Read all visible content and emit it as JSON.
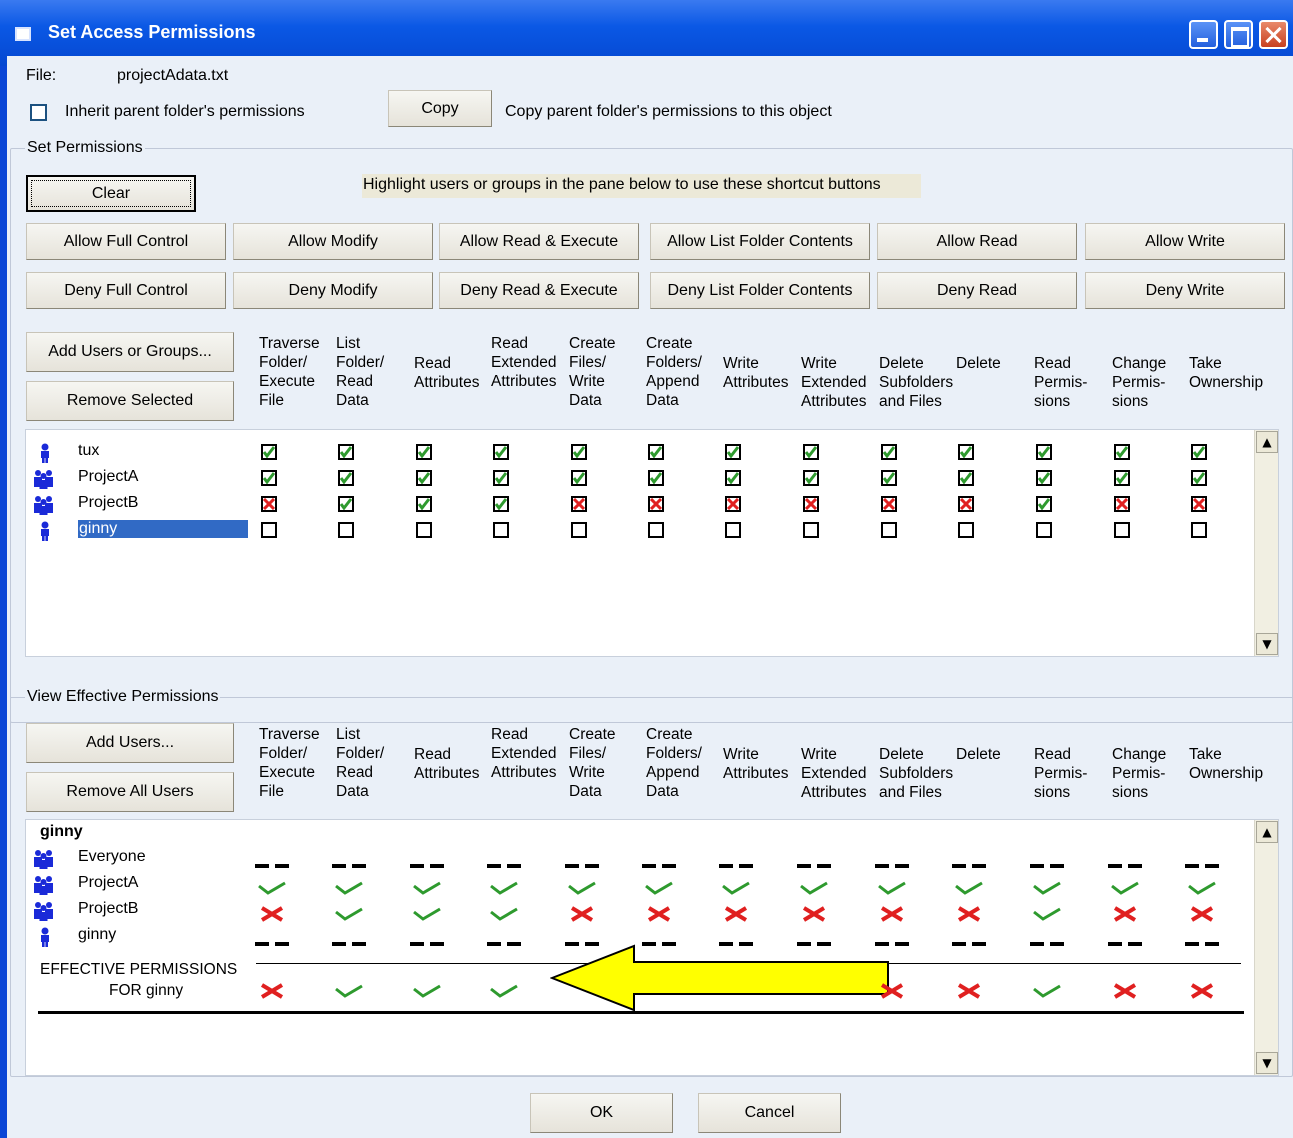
{
  "window": {
    "title": "Set Access Permissions"
  },
  "file": {
    "label": "File:",
    "name": "projectAdata.txt"
  },
  "inherit": {
    "label": "Inherit parent folder's permissions",
    "checked": false
  },
  "copy": {
    "button": "Copy",
    "desc": "Copy parent folder's permissions to this object"
  },
  "set_permissions": {
    "title": "Set Permissions",
    "clear_button": "Clear",
    "hint": "Highlight users or groups in the pane below to use these shortcut buttons",
    "allow_buttons": [
      "Allow Full Control",
      "Allow Modify",
      "Allow Read & Execute",
      "Allow List Folder Contents",
      "Allow Read",
      "Allow Write"
    ],
    "deny_buttons": [
      "Deny Full Control",
      "Deny Modify",
      "Deny Read & Execute",
      "Deny List Folder Contents",
      "Deny Read",
      "Deny Write"
    ],
    "add_button": "Add Users or Groups...",
    "remove_button": "Remove Selected",
    "columns": [
      "Traverse\nFolder/\nExecute\nFile",
      "List\nFolder/\nRead\nData",
      "Read\nAttributes",
      "Read\nExtended\nAttributes",
      "Create\nFiles/\nWrite\nData",
      "Create\nFolders/\nAppend\nData",
      "Write\nAttributes",
      "Write\nExtended\nAttributes",
      "Delete\nSubfolders\nand Files",
      "Delete",
      "Read\nPermis-\nsions",
      "Change\nPermis-\nsions",
      "Take\nOwnership"
    ],
    "rows": [
      {
        "name": "tux",
        "icon": "user-icon",
        "states": [
          "allow",
          "allow",
          "allow",
          "allow",
          "allow",
          "allow",
          "allow",
          "allow",
          "allow",
          "allow",
          "allow",
          "allow",
          "allow"
        ]
      },
      {
        "name": "ProjectA",
        "icon": "group-icon",
        "states": [
          "allow",
          "allow",
          "allow",
          "allow",
          "allow",
          "allow",
          "allow",
          "allow",
          "allow",
          "allow",
          "allow",
          "allow",
          "allow"
        ]
      },
      {
        "name": "ProjectB",
        "icon": "group-icon",
        "states": [
          "deny",
          "allow",
          "allow",
          "allow",
          "deny",
          "deny",
          "deny",
          "deny",
          "deny",
          "deny",
          "allow",
          "deny",
          "deny"
        ]
      },
      {
        "name": "ginny",
        "icon": "user-icon",
        "selected": true,
        "states": [
          "none",
          "none",
          "none",
          "none",
          "none",
          "none",
          "none",
          "none",
          "none",
          "none",
          "none",
          "none",
          "none"
        ]
      }
    ]
  },
  "effective": {
    "title": "View Effective Permissions",
    "add_button": "Add Users...",
    "remove_button": "Remove All Users",
    "columns": [
      "Traverse\nFolder/\nExecute\nFile",
      "List\nFolder/\nRead\nData",
      "Read\nAttributes",
      "Read\nExtended\nAttributes",
      "Create\nFiles/\nWrite\nData",
      "Create\nFolders/\nAppend\nData",
      "Write\nAttributes",
      "Write\nExtended\nAttributes",
      "Delete\nSubfolders\nand Files",
      "Delete",
      "Read\nPermis-\nsions",
      "Change\nPermis-\nsions",
      "Take\nOwnership"
    ],
    "user": "ginny",
    "rows": [
      {
        "name": "Everyone",
        "icon": "group-icon",
        "states": [
          "none",
          "none",
          "none",
          "none",
          "none",
          "none",
          "none",
          "none",
          "none",
          "none",
          "none",
          "none",
          "none"
        ]
      },
      {
        "name": "ProjectA",
        "icon": "group-icon",
        "states": [
          "allow",
          "allow",
          "allow",
          "allow",
          "allow",
          "allow",
          "allow",
          "allow",
          "allow",
          "allow",
          "allow",
          "allow",
          "allow"
        ]
      },
      {
        "name": "ProjectB",
        "icon": "group-icon",
        "states": [
          "deny",
          "allow",
          "allow",
          "allow",
          "deny",
          "deny",
          "deny",
          "deny",
          "deny",
          "deny",
          "allow",
          "deny",
          "deny"
        ]
      },
      {
        "name": "ginny",
        "icon": "user-icon",
        "states": [
          "none",
          "none",
          "none",
          "none",
          "none",
          "none",
          "none",
          "none",
          "none",
          "none",
          "none",
          "none",
          "none"
        ]
      }
    ],
    "result_label_1": "EFFECTIVE PERMISSIONS",
    "result_label_2": "FOR ginny",
    "result_states": [
      "deny",
      "allow",
      "allow",
      "allow",
      "hidden",
      "hidden",
      "hidden",
      "hidden",
      "deny",
      "deny",
      "allow",
      "deny",
      "deny"
    ]
  },
  "footer": {
    "ok": "OK",
    "cancel": "Cancel"
  },
  "colors": {
    "allow": "#2e9a2e",
    "deny": "#e02020",
    "arrow": "#ffff00"
  }
}
